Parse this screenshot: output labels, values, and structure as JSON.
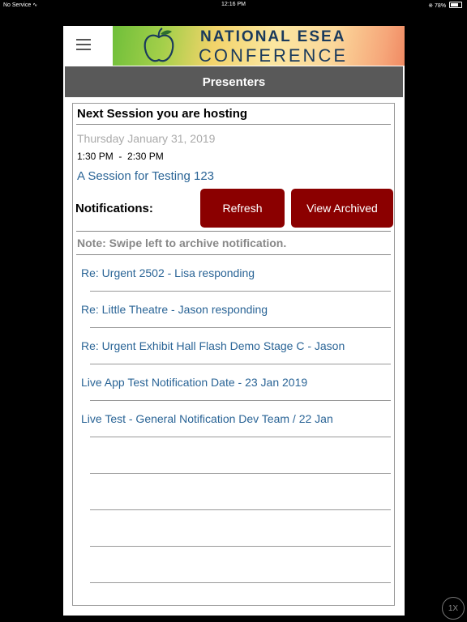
{
  "status_bar": {
    "carrier": "No Service",
    "time": "12:16 PM",
    "battery": "78%",
    "battery_level": 0.78
  },
  "header": {
    "menu_icon": "hamburger-menu-icon",
    "banner_line1": "NATIONAL ESEA",
    "banner_line2": "CONFERENCE",
    "logo_icon": "apple-outline-icon"
  },
  "title": "Presenters",
  "session": {
    "heading": "Next Session you are hosting",
    "date": "Thursday January 31, 2019",
    "time": "1:30 PM  -  2:30 PM",
    "link": "A Session for Testing 123"
  },
  "notifications": {
    "label": "Notifications:",
    "refresh_label": "Refresh",
    "archived_label": "View Archived",
    "note": "Note: Swipe left to archive notification.",
    "items": [
      "Re: Urgent 2502 - Lisa responding",
      "Re: Little Theatre - Jason responding",
      "Re: Urgent Exhibit Hall Flash Demo Stage C - Jason",
      "Live App Test Notification Date - 23 Jan 2019",
      "Live Test - General Notification Dev Team / 22 Jan",
      "",
      "",
      "",
      ""
    ]
  },
  "colors": {
    "title_bar": "#595959",
    "button": "#8b0000",
    "link": "#2a6496",
    "brand_navy": "#1a3a5c"
  },
  "zoom_label": "1X"
}
